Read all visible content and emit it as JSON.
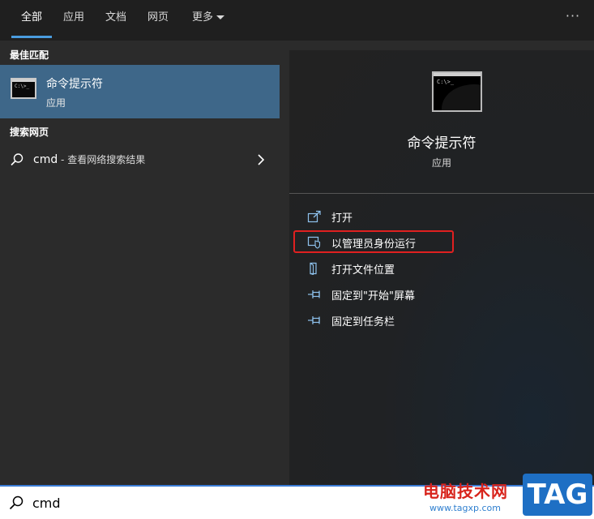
{
  "tabs": [
    {
      "label": "全部",
      "active": true
    },
    {
      "label": "应用",
      "active": false
    },
    {
      "label": "文档",
      "active": false
    },
    {
      "label": "网页",
      "active": false
    },
    {
      "label": "更多",
      "active": false
    }
  ],
  "overflow_menu": "···",
  "best_match": {
    "header": "最佳匹配",
    "title": "命令提示符",
    "subtitle": "应用"
  },
  "web_search": {
    "header": "搜索网页",
    "term": "cmd",
    "suffix": " - 查看网络搜索结果"
  },
  "detail": {
    "icon_prompt": "C:\\>_",
    "title": "命令提示符",
    "subtitle": "应用",
    "actions": [
      {
        "label": "打开",
        "icon": "open-icon"
      },
      {
        "label": "以管理员身份运行",
        "icon": "shield-admin-icon",
        "highlighted": true
      },
      {
        "label": "打开文件位置",
        "icon": "folder-location-icon"
      },
      {
        "label": "固定到\"开始\"屏幕",
        "icon": "pin-icon"
      },
      {
        "label": "固定到任务栏",
        "icon": "pin-icon"
      }
    ]
  },
  "search": {
    "value": "cmd",
    "placeholder": ""
  },
  "watermark": {
    "site_name": "电脑技术网",
    "url": "www.tagxp.com",
    "logo": "TAG"
  },
  "colors": {
    "accent": "#4a9cde",
    "selection": "#3e6789",
    "highlight_border": "#e02020",
    "panel_bg": "#2b2b2b"
  }
}
